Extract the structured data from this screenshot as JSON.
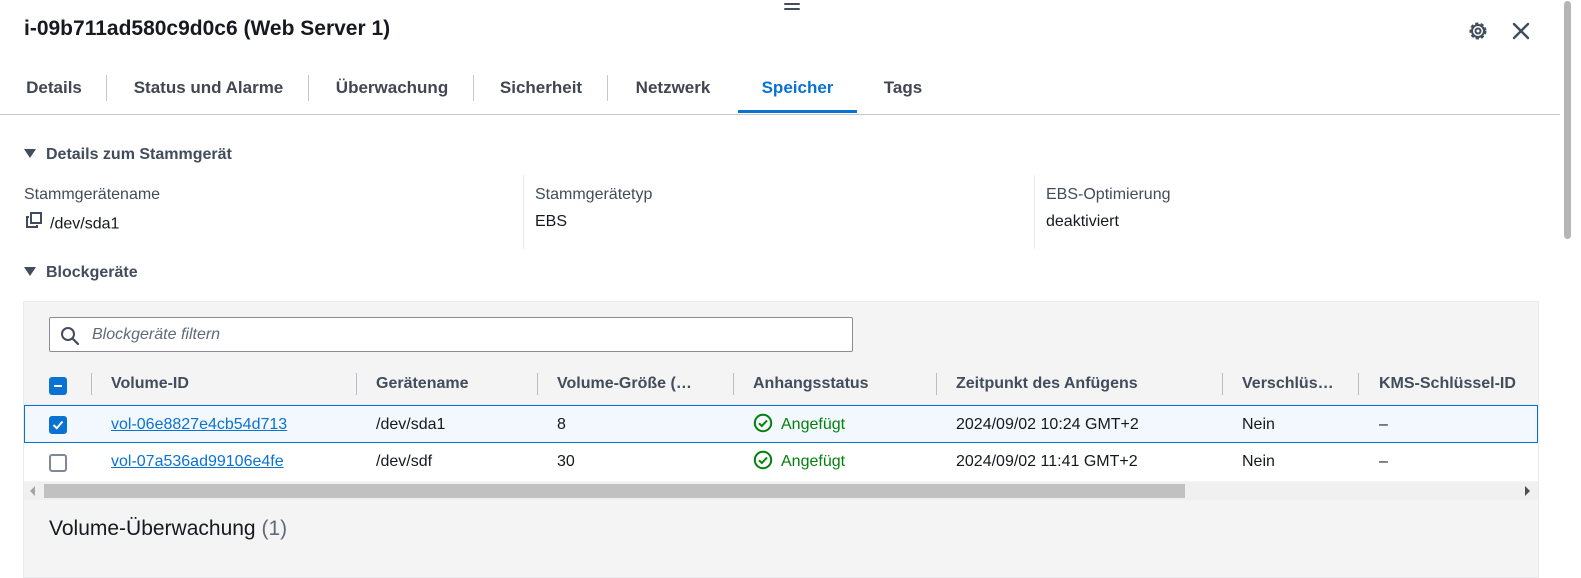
{
  "header": {
    "title": "i-09b711ad580c9d0c6 (Web Server 1)"
  },
  "tabs": [
    {
      "label": "Details"
    },
    {
      "label": "Status und Alarme"
    },
    {
      "label": "Überwachung"
    },
    {
      "label": "Sicherheit"
    },
    {
      "label": "Netzwerk"
    },
    {
      "label": "Speicher",
      "active": true
    },
    {
      "label": "Tags"
    }
  ],
  "root_device": {
    "section_title": "Details zum Stammgerät",
    "name_label": "Stammgerätename",
    "name_value": "/dev/sda1",
    "type_label": "Stammgerätetyp",
    "type_value": "EBS",
    "ebs_label": "EBS-Optimierung",
    "ebs_value": "deaktiviert"
  },
  "block_devices": {
    "section_title": "Blockgeräte",
    "filter_placeholder": "Blockgeräte filtern",
    "columns": [
      "Volume-ID",
      "Gerätename",
      "Volume-Größe (…",
      "Anhangsstatus",
      "Zeitpunkt des Anfügens",
      "Verschlüs…",
      "KMS-Schlüssel-ID"
    ],
    "rows": [
      {
        "volume_id": "vol-06e8827e4cb54d713",
        "device": "/dev/sda1",
        "size": "8",
        "status": "Angefügt",
        "attached_at": "2024/09/02 10:24 GMT+2",
        "encrypted": "Nein",
        "kms": "–",
        "selected": true
      },
      {
        "volume_id": "vol-07a536ad99106e4fe",
        "device": "/dev/sdf",
        "size": "30",
        "status": "Angefügt",
        "attached_at": "2024/09/02 11:41 GMT+2",
        "encrypted": "Nein",
        "kms": "–",
        "selected": false
      }
    ]
  },
  "volume_monitoring": {
    "title": "Volume-Überwachung",
    "count": "(1)"
  },
  "colors": {
    "accent": "#0972d3",
    "success": "#037f0c",
    "text": "#16191f",
    "muted": "#414d5c"
  },
  "icons": [
    "drag-handle-icon",
    "settings-icon",
    "close-icon",
    "caret-down-icon",
    "copy-icon",
    "search-icon",
    "status-success-icon",
    "checkbox-indeterminate-icon"
  ]
}
